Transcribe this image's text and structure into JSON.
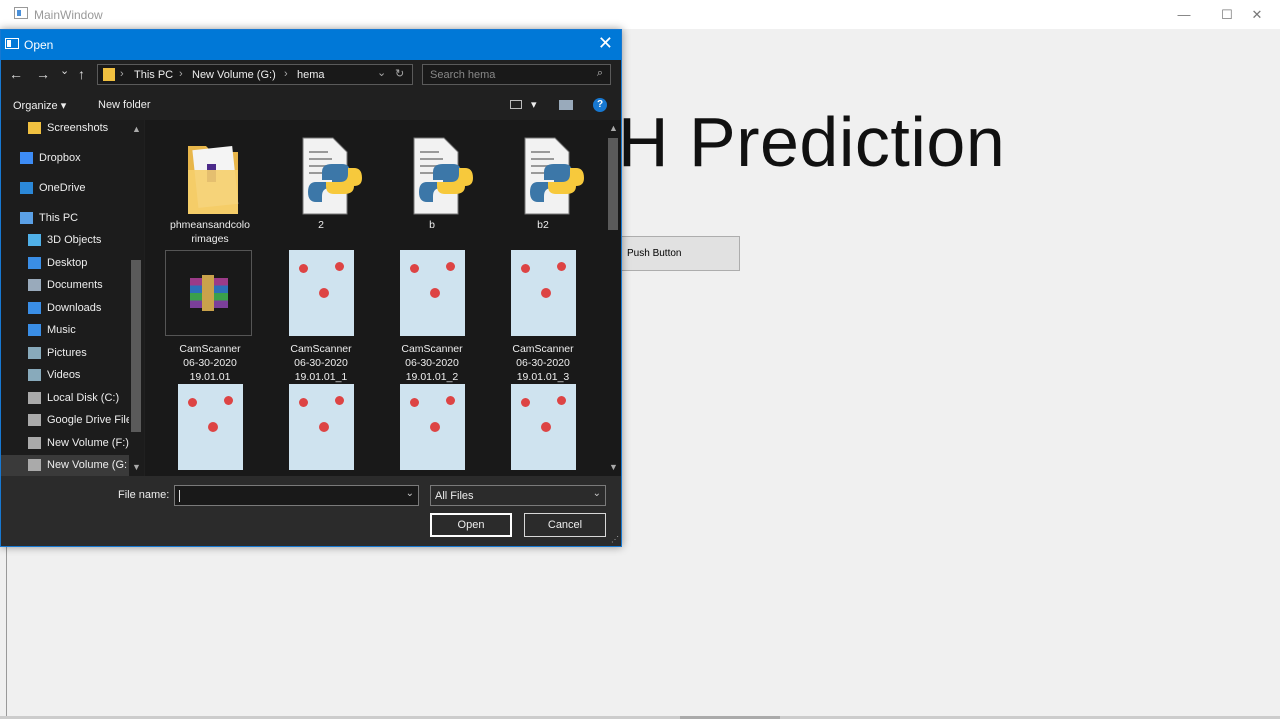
{
  "main_window": {
    "title": "MainWindow",
    "heading": "H Prediction",
    "push_button": "Push Button",
    "minimize": "—",
    "maximize": "☐",
    "close": "✕"
  },
  "dialog": {
    "title": "Open",
    "close": "✕",
    "nav": {
      "back": "←",
      "forward": "→",
      "recent": "⌄",
      "up": "↑",
      "refresh": "↻",
      "dropdown": "⌄"
    },
    "breadcrumb": [
      "This PC",
      "New Volume (G:)",
      "hema"
    ],
    "search_placeholder": "Search hema",
    "toolbar": {
      "organize": "Organize ▾",
      "new_folder": "New folder",
      "view_dropdown": "▾",
      "help": "?"
    },
    "nav_items": [
      {
        "label": "Screenshots",
        "icon": "folder-icon",
        "color": "#f0c040"
      },
      {
        "label": "Dropbox",
        "icon": "dropbox-icon",
        "color": "#3d8cf5"
      },
      {
        "label": "OneDrive",
        "icon": "onedrive-icon",
        "color": "#2b88d8"
      },
      {
        "label": "This PC",
        "icon": "computer-icon",
        "color": "#5aa0e6"
      },
      {
        "label": "3D Objects",
        "icon": "cube-icon",
        "color": "#50b0e8"
      },
      {
        "label": "Desktop",
        "icon": "desktop-icon",
        "color": "#3a8ee6"
      },
      {
        "label": "Documents",
        "icon": "documents-icon",
        "color": "#9ab"
      },
      {
        "label": "Downloads",
        "icon": "download-icon",
        "color": "#3a8ee6"
      },
      {
        "label": "Music",
        "icon": "music-icon",
        "color": "#3a8ee6"
      },
      {
        "label": "Pictures",
        "icon": "pictures-icon",
        "color": "#8ab"
      },
      {
        "label": "Videos",
        "icon": "videos-icon",
        "color": "#8ab"
      },
      {
        "label": "Local Disk (C:)",
        "icon": "drive-icon",
        "color": "#aaa"
      },
      {
        "label": "Google Drive File",
        "icon": "drive-icon",
        "color": "#aaa"
      },
      {
        "label": "New Volume (F:)",
        "icon": "drive-icon",
        "color": "#aaa"
      },
      {
        "label": "New Volume (G:",
        "icon": "drive-icon",
        "color": "#aaa"
      }
    ],
    "files": [
      {
        "name": "phmeansandcolo\nrimages",
        "type": "folder"
      },
      {
        "name": "2",
        "type": "python"
      },
      {
        "name": "b",
        "type": "python"
      },
      {
        "name": "b2",
        "type": "python"
      },
      {
        "name": "CamScanner\n06-30-2020\n19.01.01",
        "type": "archive"
      },
      {
        "name": "CamScanner\n06-30-2020\n19.01.01_1",
        "type": "image"
      },
      {
        "name": "CamScanner\n06-30-2020\n19.01.01_2",
        "type": "image"
      },
      {
        "name": "CamScanner\n06-30-2020\n19.01.01_3",
        "type": "image"
      },
      {
        "name": "",
        "type": "image"
      },
      {
        "name": "",
        "type": "image"
      },
      {
        "name": "",
        "type": "image"
      },
      {
        "name": "",
        "type": "image"
      }
    ],
    "footer": {
      "file_name_label": "File name:",
      "file_name_value": "",
      "filter": "All Files",
      "open": "Open",
      "cancel": "Cancel"
    }
  }
}
